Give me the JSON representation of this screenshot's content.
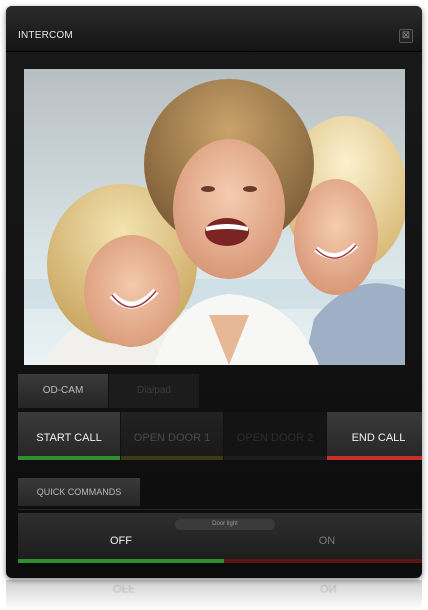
{
  "window": {
    "title": "INTERCOM",
    "close_symbol": "⊠"
  },
  "video": {
    "description_icon": "camera-feed"
  },
  "tabs": [
    {
      "label": "OD-CAM",
      "active": true
    },
    {
      "label": "Dialpad",
      "active": false
    }
  ],
  "call_buttons": [
    {
      "label": "START CALL",
      "enabled": true,
      "bar_color": "#2f8f2f"
    },
    {
      "label": "OPEN DOOR 1",
      "enabled": false,
      "bar_color": "#3a3a16"
    },
    {
      "label": "OPEN DOOR 2",
      "enabled": false,
      "bar_color": "#1e1e1e"
    },
    {
      "label": "END CALL",
      "enabled": true,
      "bar_color": "#c9302c"
    }
  ],
  "quick_commands": {
    "label": "QUICK COMMANDS"
  },
  "door_light": {
    "label": "Door light",
    "off_label": "OFF",
    "on_label": "ON",
    "state": "off",
    "off_bar_color": "#2f8f2f",
    "on_bar_color": "#5a1515"
  }
}
